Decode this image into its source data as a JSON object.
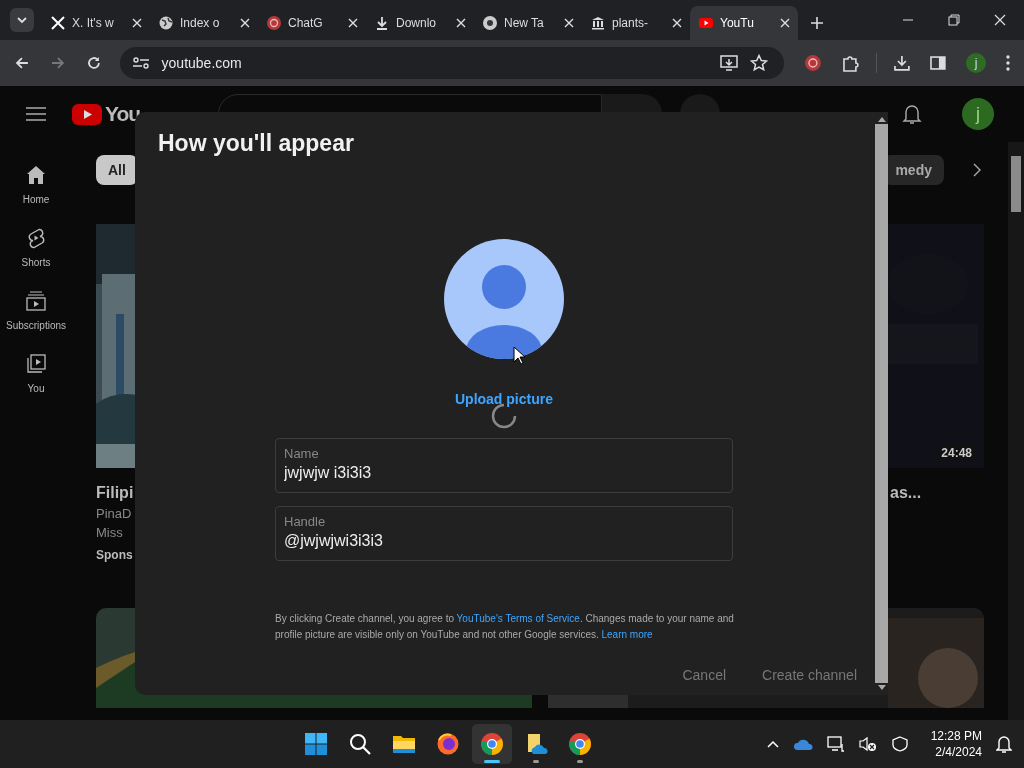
{
  "browser": {
    "tabs": [
      {
        "title": "X. It's w",
        "kind": "x",
        "selected": false
      },
      {
        "title": "Index o",
        "kind": "globe",
        "selected": false
      },
      {
        "title": "ChatG",
        "kind": "openai",
        "selected": false
      },
      {
        "title": "Downlo",
        "kind": "download",
        "selected": false
      },
      {
        "title": "New Ta",
        "kind": "chrome",
        "selected": false
      },
      {
        "title": "plants-",
        "kind": "museum",
        "selected": false
      },
      {
        "title": "YouTu",
        "kind": "youtube",
        "selected": true
      }
    ],
    "address": "youtube.com",
    "profile": "j"
  },
  "youtube": {
    "logo": "You",
    "avatar": "j",
    "sidebar": [
      {
        "label": "Home",
        "kind": "home"
      },
      {
        "label": "Shorts",
        "kind": "shorts"
      },
      {
        "label": "Subscriptions",
        "kind": "subscriptions"
      },
      {
        "label": "You",
        "kind": "you"
      }
    ],
    "chips": [
      {
        "label": "All",
        "selected": true
      },
      {
        "label": "medy",
        "selected": false
      }
    ],
    "left_video": {
      "title": "Filipi",
      "channel": "PinaD",
      "meta": "Miss",
      "badge": "Spons"
    },
    "right_video": {
      "duration": "24:48",
      "title": "as..."
    }
  },
  "dialog": {
    "title": "How you'll appear",
    "upload": "Upload picture",
    "fields": [
      {
        "label": "Name",
        "value": "jwjwjw i3i3i3"
      },
      {
        "label": "Handle",
        "value": "@jwjwjwi3i3i3"
      }
    ],
    "notice": {
      "before": "By clicking Create channel, you agree to ",
      "terms": "YouTube's Terms of Service",
      "middle": ". Changes made to your name and profile picture are visible only on YouTube and not other Google services. ",
      "learn": "Learn more"
    },
    "buttons": [
      {
        "label": "Cancel",
        "disabled": true
      },
      {
        "label": "Create channel",
        "disabled": true
      }
    ]
  },
  "taskbar": {
    "apps": [
      {
        "kind": "start",
        "selected": false,
        "running": false
      },
      {
        "kind": "search",
        "selected": false,
        "running": false
      },
      {
        "kind": "folder",
        "selected": false,
        "running": false
      },
      {
        "kind": "firefox",
        "selected": false,
        "running": false
      },
      {
        "kind": "chrome",
        "selected": true,
        "running": true
      },
      {
        "kind": "onedrive-folder",
        "selected": false,
        "running": true
      },
      {
        "kind": "chrome",
        "selected": false,
        "running": true
      }
    ],
    "time": "12:28 PM",
    "date": "2/4/2024"
  }
}
